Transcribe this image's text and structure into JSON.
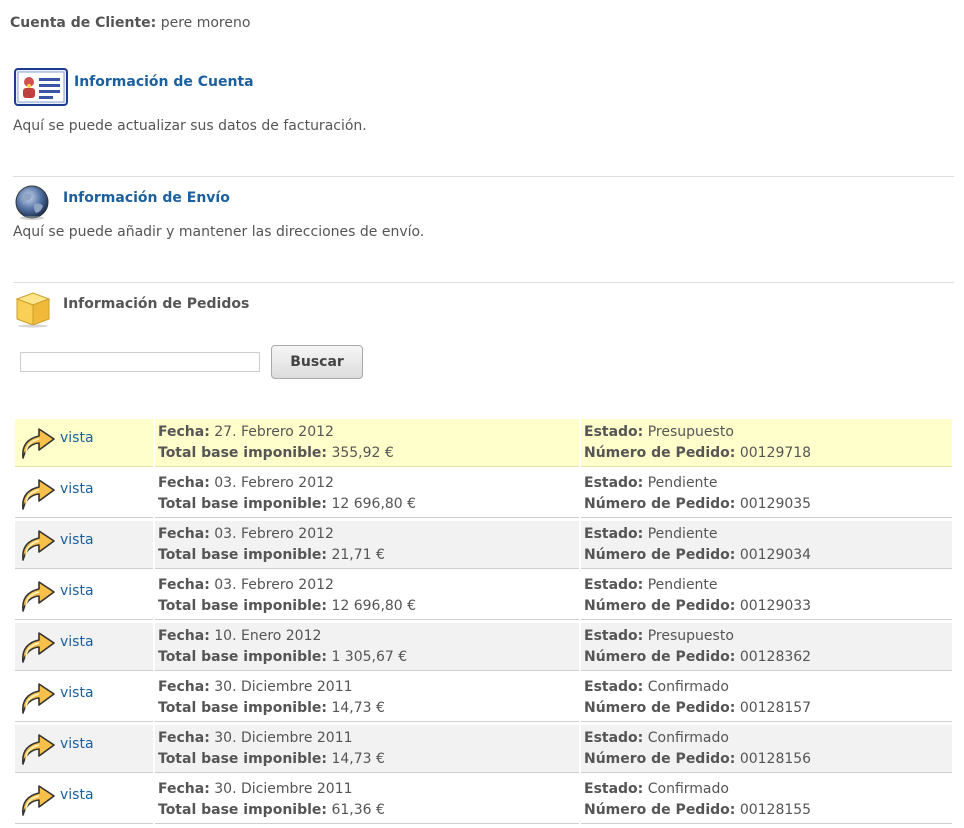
{
  "customer": {
    "label": "Cuenta de Cliente:",
    "name": "pere moreno"
  },
  "sections": {
    "account": {
      "title": "Información de Cuenta",
      "text": "Aquí se puede actualizar sus datos de facturación.",
      "icon": "account-card-icon"
    },
    "shipping": {
      "title": "Información de Envío",
      "text": "Aquí se puede añadir y mantener las direcciones de envío.",
      "icon": "globe-icon"
    },
    "orders": {
      "title": "Información de Pedidos",
      "icon": "box-icon"
    }
  },
  "search": {
    "value": "",
    "placeholder": "",
    "button_label": "Buscar"
  },
  "order_labels": {
    "view": "vista",
    "date": "Fecha:",
    "total": "Total base imponible:",
    "status": "Estado:",
    "number": "Número de Pedido:"
  },
  "orders": [
    {
      "date": "27. Febrero 2012",
      "total": "355,92 €",
      "status": "Presupuesto",
      "number": "00129718"
    },
    {
      "date": "03. Febrero 2012",
      "total": "12 696,80 €",
      "status": "Pendiente",
      "number": "00129035"
    },
    {
      "date": "03. Febrero 2012",
      "total": "21,71 €",
      "status": "Pendiente",
      "number": "00129034"
    },
    {
      "date": "03. Febrero 2012",
      "total": "12 696,80 €",
      "status": "Pendiente",
      "number": "00129033"
    },
    {
      "date": "10. Enero 2012",
      "total": "1 305,67 €",
      "status": "Presupuesto",
      "number": "00128362"
    },
    {
      "date": "30. Diciembre 2011",
      "total": "14,73 €",
      "status": "Confirmado",
      "number": "00128157"
    },
    {
      "date": "30. Diciembre 2011",
      "total": "14,73 €",
      "status": "Confirmado",
      "number": "00128156"
    },
    {
      "date": "30. Diciembre 2011",
      "total": "61,36 €",
      "status": "Confirmado",
      "number": "00128155"
    }
  ],
  "colors": {
    "link": "#1a5f9e",
    "highlight_row": "#ffffcc",
    "alt_row": "#f2f2f2",
    "text": "#555555"
  }
}
